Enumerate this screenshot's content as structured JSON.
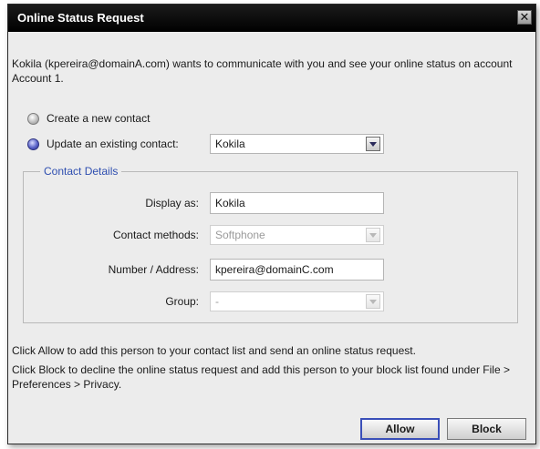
{
  "dialog": {
    "title": "Online Status Request",
    "message": "Kokila (kpereira@domainA.com) wants to communicate with you and see your online status on account Account 1."
  },
  "options": {
    "create_label": "Create a new contact",
    "update_label": "Update an existing contact:",
    "existing_contact_value": "Kokila"
  },
  "contact_details": {
    "legend": "Contact Details",
    "display_as_label": "Display as:",
    "display_as_value": "Kokila",
    "contact_methods_label": "Contact methods:",
    "contact_methods_value": "Softphone",
    "number_label": "Number / Address:",
    "number_value": "kpereira@domainC.com",
    "group_label": "Group:",
    "group_value": "-"
  },
  "info": {
    "allow_text": "Click Allow to add this person to your contact list and send an online status request.",
    "block_text": "Click Block to decline the online status request and add this person to your block list found under File > Preferences > Privacy."
  },
  "buttons": {
    "allow": "Allow",
    "block": "Block"
  },
  "colors": {
    "titlebar": "#000000",
    "accent": "#3a4fb8",
    "legend": "#2f4fb0"
  },
  "icons": {
    "close": "close-icon",
    "dropdown": "chevron-down-icon"
  }
}
